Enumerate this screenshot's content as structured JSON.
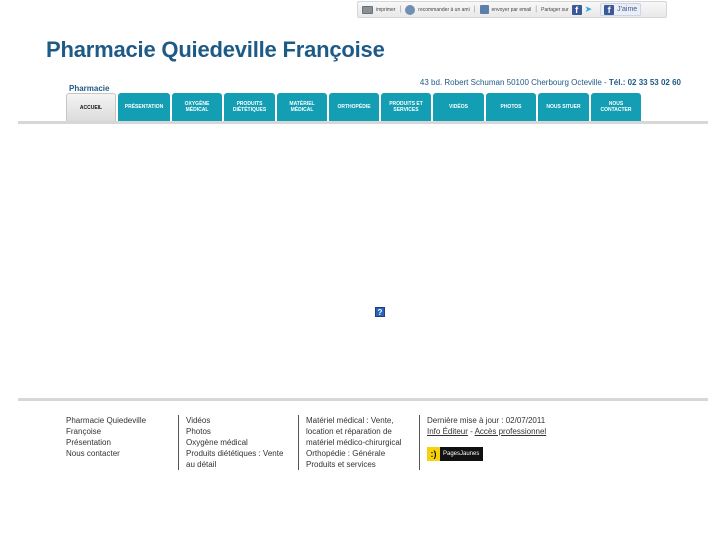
{
  "sharebar": {
    "print": "imprimer",
    "recommend": "recommander à un ami",
    "send": "envoyer par email",
    "share": "Partager sur",
    "like": "J'aime"
  },
  "header": {
    "title": "Pharmacie Quiedeville Françoise",
    "brand_small": "Pharmacie",
    "address": "43 bd. Robert Schuman 50100 Cherbourg Octeville  - ",
    "tel_label": "Tél.:",
    "tel": "02 33 53 02 60"
  },
  "nav": {
    "accueil": "ACCUEIL",
    "presentation": "PRÉSENTATION",
    "oxygene": "OXYGÈNE MÉDICAL",
    "produits_diet": "PRODUITS DIÉTÉTIQUES",
    "materiel": "MATÉRIEL MÉDICAL",
    "orthopedie": "ORTHOPÉDIE",
    "produits_services": "PRODUITS ET SERVICES",
    "videos": "VIDÉOS",
    "photos": "PHOTOS",
    "nous_situer": "NOUS SITUER",
    "nous_contacter": "NOUS CONTACTER"
  },
  "content": {
    "help_icon": "?"
  },
  "footer": {
    "col1": [
      "Pharmacie Quiedeville Françoise",
      "Présentation",
      "Nous contacter"
    ],
    "col2": [
      "Vidéos",
      "Photos",
      "Oxygène médical",
      "Produits diététiques : Vente au détail"
    ],
    "col3": [
      "Matériel médical : Vente, location et réparation de matériel médico-chirurgical",
      "Orthopédie : Générale",
      "Produits et services"
    ],
    "col4": {
      "updated": "Dernière mise à jour : 02/07/2011",
      "info_editeur": "Info Éditeur",
      "dash": " - ",
      "acces_pro": "Accès professionnel",
      "pages_jaunes": "PagesJaunes"
    }
  }
}
